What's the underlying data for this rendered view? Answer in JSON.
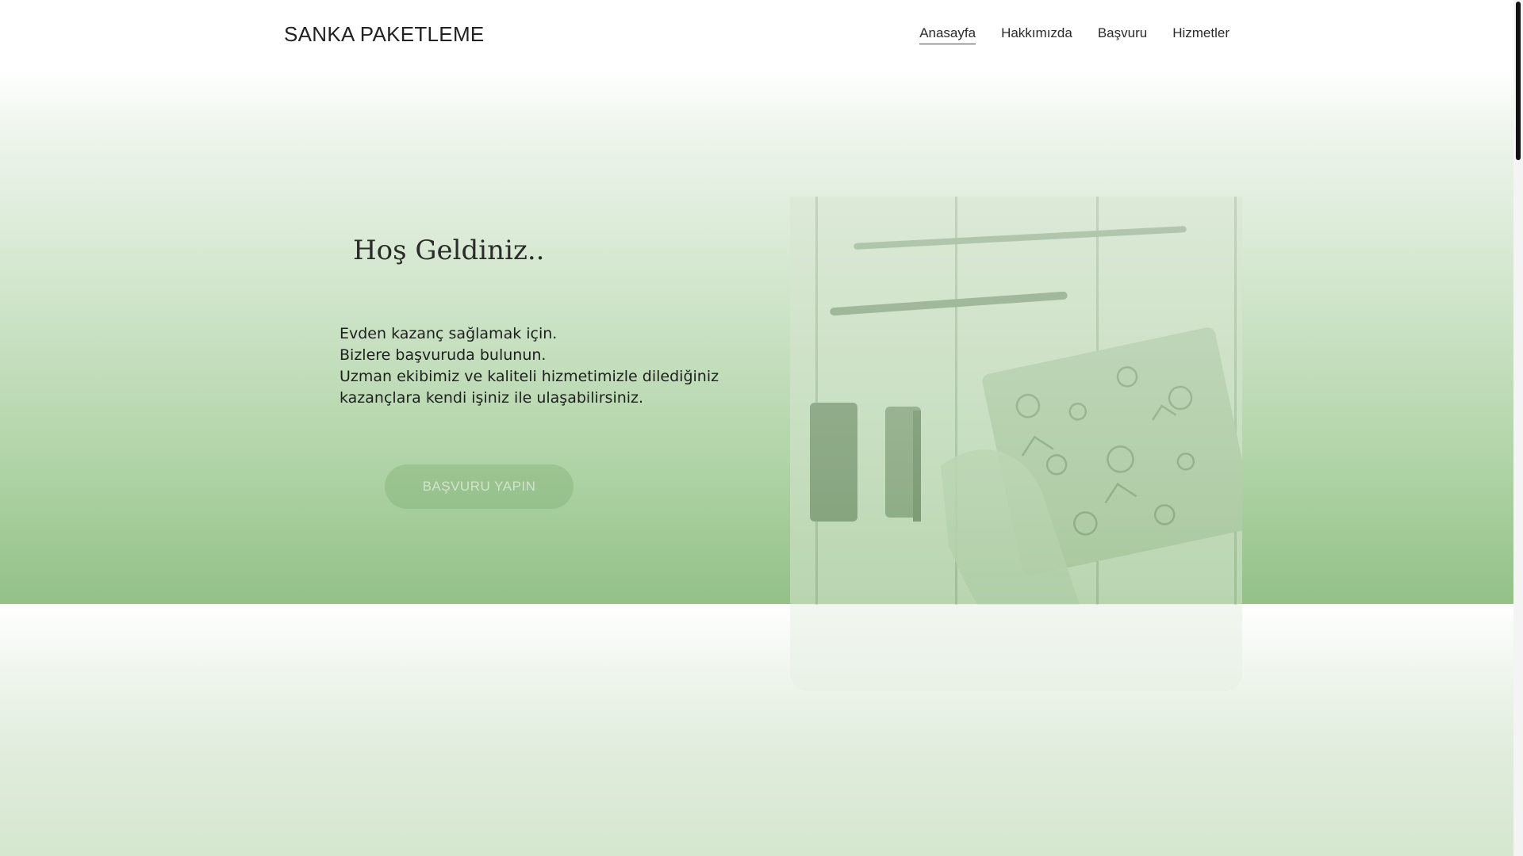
{
  "header": {
    "brand": "SANKA PAKETLEME",
    "nav": [
      {
        "label": "Anasayfa",
        "active": true
      },
      {
        "label": "Hakkımızda",
        "active": false
      },
      {
        "label": "Başvuru",
        "active": false
      },
      {
        "label": "Hizmetler",
        "active": false
      }
    ]
  },
  "hero": {
    "title": "Hoş Geldiniz..",
    "lines": [
      "Evden kazanç sağlamak için.",
      "Bizlere başvuruda bulunun.",
      "Uzman ekibimiz ve kaliteli hizmetimizle dilediğiniz",
      "kazançlara kendi işiniz ile ulaşabilirsiniz."
    ],
    "cta_label": "BAŞVURU YAPIN",
    "image_icon": "packaging-photo-icon"
  },
  "colors": {
    "accent_green": "#93c187",
    "text_dark": "#1f1f1f"
  }
}
